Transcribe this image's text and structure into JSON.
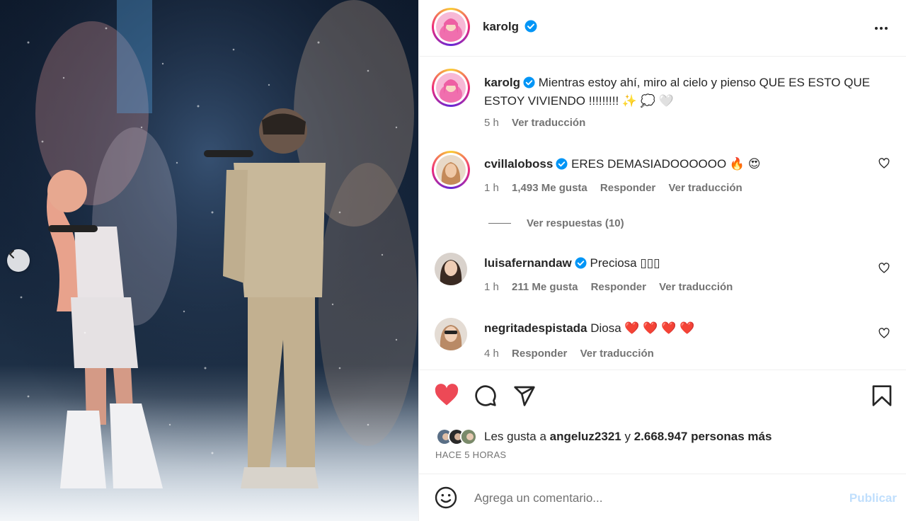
{
  "post": {
    "username": "karolg",
    "more_icon": "more-horizontal-icon",
    "caption_text": "Mientras estoy ahí, miro al cielo y pienso QUE ES ESTO QUE ESTOY VIVIENDO !!!!!!!!! ✨ 💭 🤍",
    "caption_time": "5 h",
    "caption_translate": "Ver traducción"
  },
  "comments": [
    {
      "username": "cvillaloboss",
      "text": "ERES DEMASIADOOOOOO 🔥 😍",
      "time": "1 h",
      "likes": "1,493 Me gusta",
      "reply": "Responder",
      "translate": "Ver traducción",
      "view_replies": "Ver respuestas (10)"
    },
    {
      "username": "luisafernandaw",
      "text": "Preciosa ▯▯▯",
      "time": "1 h",
      "likes": "211 Me gusta",
      "reply": "Responder",
      "translate": "Ver traducción"
    },
    {
      "username": "negritadespistada",
      "text": "Diosa ❤️ ❤️ ❤️ ❤️",
      "time": "4 h",
      "reply": "Responder",
      "translate": "Ver traducción"
    }
  ],
  "actions": {
    "like_icon": "heart-filled-icon",
    "comment_icon": "comment-icon",
    "share_icon": "send-icon",
    "save_icon": "bookmark-icon",
    "likes_prefix": "Les gusta a",
    "likes_user": "angeluz2321",
    "likes_connector": "y",
    "likes_others": "2.668.947 personas más",
    "time_ago": "HACE 5 HORAS"
  },
  "composer": {
    "emoji_icon": "emoji-icon",
    "placeholder": "Agrega un comentario...",
    "publish_label": "Publicar"
  },
  "colors": {
    "like_red": "#ed4956",
    "verified_blue": "#0095f6",
    "publish_disabled": "#c0dffd",
    "meta_gray": "#737373"
  }
}
